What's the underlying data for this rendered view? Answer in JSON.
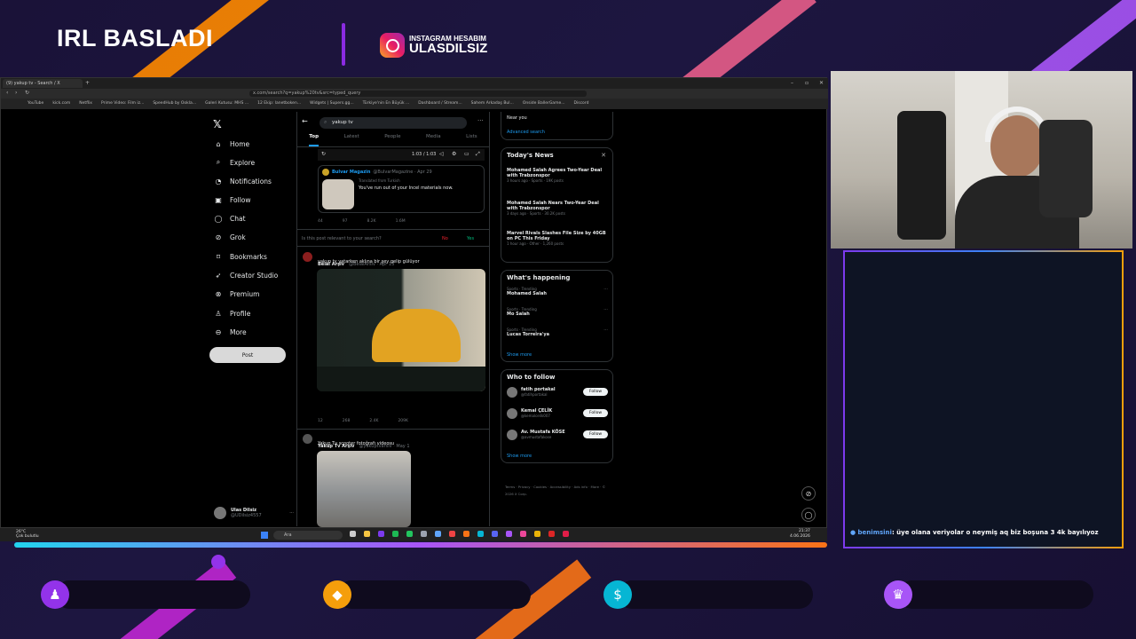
{
  "overlay": {
    "title": "IRL BASLADI",
    "instagram_label": "INSTAGRAM HESABIM",
    "instagram_handle": "ULASDILSIZ"
  },
  "browser": {
    "tab_title": "(9) yakup tv - Search / X",
    "url": "x.com/search?q=yakup%20tv&src=typed_query",
    "bookmarks": [
      "YouTube",
      "kick.com",
      "Netflix",
      "Prime Video: Film iz...",
      "SpeedHub by Ookla...",
      "Galeri Kutusu: MHS ...",
      "12 Ekip: lanetboken...",
      "Widgets | Supers.gg...",
      "Türkiye'nin En Büyük ...",
      "Dashboard / Stream...",
      "Sahem Arkadaş Bul...",
      "Onside BallerGame...",
      "Discord"
    ]
  },
  "x_nav": {
    "items": [
      {
        "icon": "⌂",
        "label": "Home"
      },
      {
        "icon": "⌕",
        "label": "Explore"
      },
      {
        "icon": "◔",
        "label": "Notifications"
      },
      {
        "icon": "▣",
        "label": "Follow"
      },
      {
        "icon": "◯",
        "label": "Chat"
      },
      {
        "icon": "⊘",
        "label": "Grok"
      },
      {
        "icon": "⌑",
        "label": "Bookmarks"
      },
      {
        "icon": "➶",
        "label": "Creator Studio"
      },
      {
        "icon": "⊗",
        "label": "Premium"
      },
      {
        "icon": "♙",
        "label": "Profile"
      },
      {
        "icon": "⊖",
        "label": "More"
      }
    ],
    "post_label": "Post",
    "profile_name": "Ulas Dilsiz",
    "profile_handle": "@UDilsiz4557"
  },
  "feed": {
    "search_value": "yakup tv",
    "tabs": [
      "Top",
      "Latest",
      "People",
      "Media",
      "Lists"
    ],
    "video_time": "1:03 / 1:03",
    "tweet1": {
      "name": "Bulvar Magazin",
      "handle": "@BulvarMagazine · Apr 29",
      "translated": "Translated from Turkish",
      "text": "You've run out of your Incel materials now.",
      "stats": [
        "44",
        "97",
        "8.2K",
        "1.6M"
      ]
    },
    "relevance_q": "Is this post relevant to your search?",
    "relevance_no": "No",
    "relevance_yes": "Yes",
    "tweet2": {
      "name": "Belal Arşiv",
      "handle": "@BelalArsiv · Apr 13",
      "text": "yakup tv yatarken aklına bir şey gelip gülüyor",
      "stats": [
        "12",
        "268",
        "2.4K",
        "209K"
      ]
    },
    "tweet3": {
      "name": "Yakup Tv Arşiv",
      "handle": "@yakuptvarsiv · May 1",
      "text": "Yakup Tv scooter fotoğrafı videosu"
    }
  },
  "right": {
    "near_you": "Near you",
    "advanced": "Advanced search",
    "news_title": "Today's News",
    "news": [
      {
        "title": "Mohamed Salah Agrees Two-Year Deal with Trabzonspor",
        "meta": "3 hours ago · Sports · 19K posts"
      },
      {
        "title": "Mohamed Salah Nears Two-Year Deal with Trabzonspor",
        "meta": "3 days ago · Sports · 30.2K posts"
      },
      {
        "title": "Marvel Rivals Slashes File Size by 40GB on PC This Friday",
        "meta": "1 hour ago · Other · 1,260 posts"
      }
    ],
    "happening_title": "What's happening",
    "happening": [
      {
        "meta": "Sports · Trending",
        "title": "Mohamed Salah"
      },
      {
        "meta": "Sports · Trending",
        "title": "Mo Salah"
      },
      {
        "meta": "Sports · Trending",
        "title": "Lucas Torreira'ya"
      }
    ],
    "show_more": "Show more",
    "wtf_title": "Who to follow",
    "wtf": [
      {
        "name": "fatih portakal",
        "handle": "@fatihportakal"
      },
      {
        "name": "Kemal ÇELİK",
        "handle": "@kemalcelik007"
      },
      {
        "name": "Av. Mustafa KÖSE",
        "handle": "@avmustafakose"
      }
    ],
    "follow_label": "Follow",
    "footer": "Terms · Privacy · Cookies · Accessibility · Ads info · More · © 2026 X Corp."
  },
  "taskbar": {
    "weather_temp": "26°C",
    "weather_text": "Çok bulutlu",
    "search_label": "Ara",
    "clock_time": "21:37",
    "clock_date": "4.06.2026"
  },
  "chat": {
    "user": "benimsini",
    "message": ": üye olana veriyolar o neymiş aq biz boşuna 3 4k bayılıyoz"
  },
  "colors": {
    "accent_purple": "#8a2be2",
    "x_blue": "#1d9bf0",
    "bg": "#1a1238"
  }
}
